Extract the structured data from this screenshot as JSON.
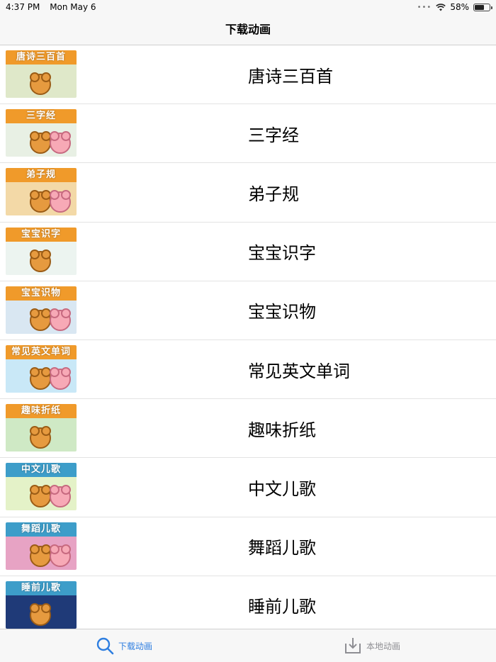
{
  "status_bar": {
    "time": "4:37 PM",
    "date": "Mon May 6",
    "battery": "58%",
    "battery_level": 0.58
  },
  "nav": {
    "title": "下载动画"
  },
  "items": [
    {
      "label": "唐诗三百首",
      "thumb_title": "唐诗三百首",
      "head_color": "#f09a2a",
      "body_color": "#dfe8c9"
    },
    {
      "label": "三字经",
      "thumb_title": "三字经",
      "head_color": "#f09a2a",
      "body_color": "#e8f0e4"
    },
    {
      "label": "弟子规",
      "thumb_title": "弟子规",
      "head_color": "#f09a2a",
      "body_color": "#f3d9a7"
    },
    {
      "label": "宝宝识字",
      "thumb_title": "宝宝识字",
      "head_color": "#f09a2a",
      "body_color": "#ecf4f0"
    },
    {
      "label": "宝宝识物",
      "thumb_title": "宝宝识物",
      "head_color": "#f09a2a",
      "body_color": "#d9e7f2"
    },
    {
      "label": "常见英文单词",
      "thumb_title": "常见英文单词",
      "head_color": "#f09a2a",
      "body_color": "#c9e8f7"
    },
    {
      "label": "趣味折纸",
      "thumb_title": "趣味折纸",
      "head_color": "#f09a2a",
      "body_color": "#cfe9c5"
    },
    {
      "label": "中文儿歌",
      "thumb_title": "中文儿歌",
      "head_color": "#3d9dc9",
      "body_color": "#e4f2c8"
    },
    {
      "label": "舞蹈儿歌",
      "thumb_title": "舞蹈儿歌",
      "head_color": "#3d9dc9",
      "body_color": "#e7a3c4"
    },
    {
      "label": "睡前儿歌",
      "thumb_title": "睡前儿歌",
      "head_color": "#3d9dc9",
      "body_color": "#1f3a78"
    }
  ],
  "tabs": [
    {
      "label": "下载动画",
      "icon": "search-icon",
      "active": true
    },
    {
      "label": "本地动画",
      "icon": "download-tray-icon",
      "active": false
    }
  ],
  "colors": {
    "accent": "#2e7ee0",
    "inactive": "#8e8e93"
  }
}
